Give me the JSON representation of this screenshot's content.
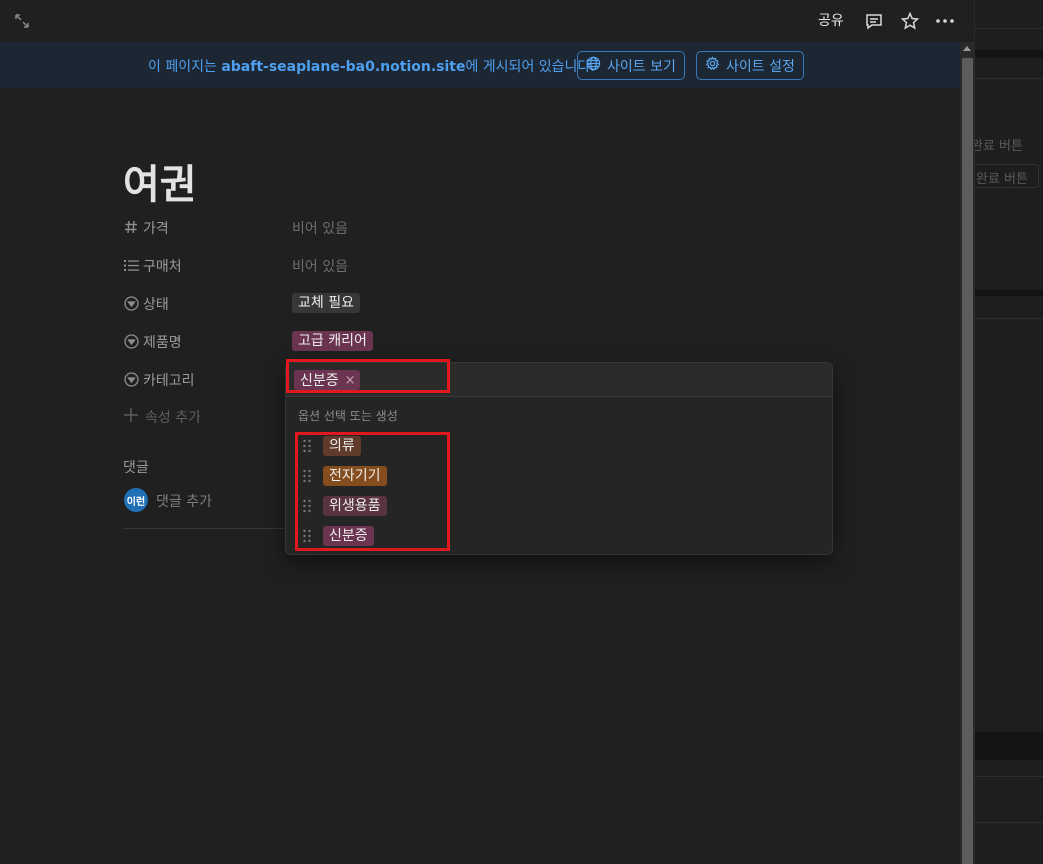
{
  "background_app": {
    "text_1": "완료 버튼",
    "text_2": "완료 버튼"
  },
  "topbar": {
    "share_label": "공유",
    "icons": [
      "expand-icon",
      "comment-icon",
      "star-icon",
      "more-icon"
    ]
  },
  "banner": {
    "text_prefix": "이 페이지는 ",
    "site": "abaft-seaplane-ba0.notion.site",
    "text_suffix": "에 게시되어 있습니다.",
    "view_site_label": "사이트 보기",
    "site_settings_label": "사이트 설정"
  },
  "page": {
    "title": "여권",
    "properties": [
      {
        "icon": "number-icon",
        "label": "가격",
        "value": "비어 있음"
      },
      {
        "icon": "list-icon",
        "label": "구매처",
        "value": "비어 있음"
      },
      {
        "icon": "select-icon",
        "label": "상태",
        "tag": "교체 필요",
        "tag_color": "#373737"
      },
      {
        "icon": "select-icon",
        "label": "제품명",
        "tag": "고급 캐리어",
        "tag_color": "#6b3551"
      },
      {
        "icon": "select-icon",
        "label": "카테고리"
      }
    ],
    "add_property_label": "속성 추가",
    "comments_heading": "댓글",
    "avatar_initials": "이런",
    "add_comment_label": "댓글 추가"
  },
  "dropdown": {
    "selected": {
      "label": "신분증",
      "color": "#6b3551",
      "remove": "×"
    },
    "hint": "옵션 선택 또는 생성",
    "options": [
      {
        "label": "의류",
        "color": "#603b2c"
      },
      {
        "label": "전자기기",
        "color": "#854c1d"
      },
      {
        "label": "위생용품",
        "color": "#5a3341"
      },
      {
        "label": "신분증",
        "color": "#6b3551"
      }
    ]
  },
  "colors": {
    "highlight": "#e0191f",
    "banner_link": "#4d9ff0"
  }
}
